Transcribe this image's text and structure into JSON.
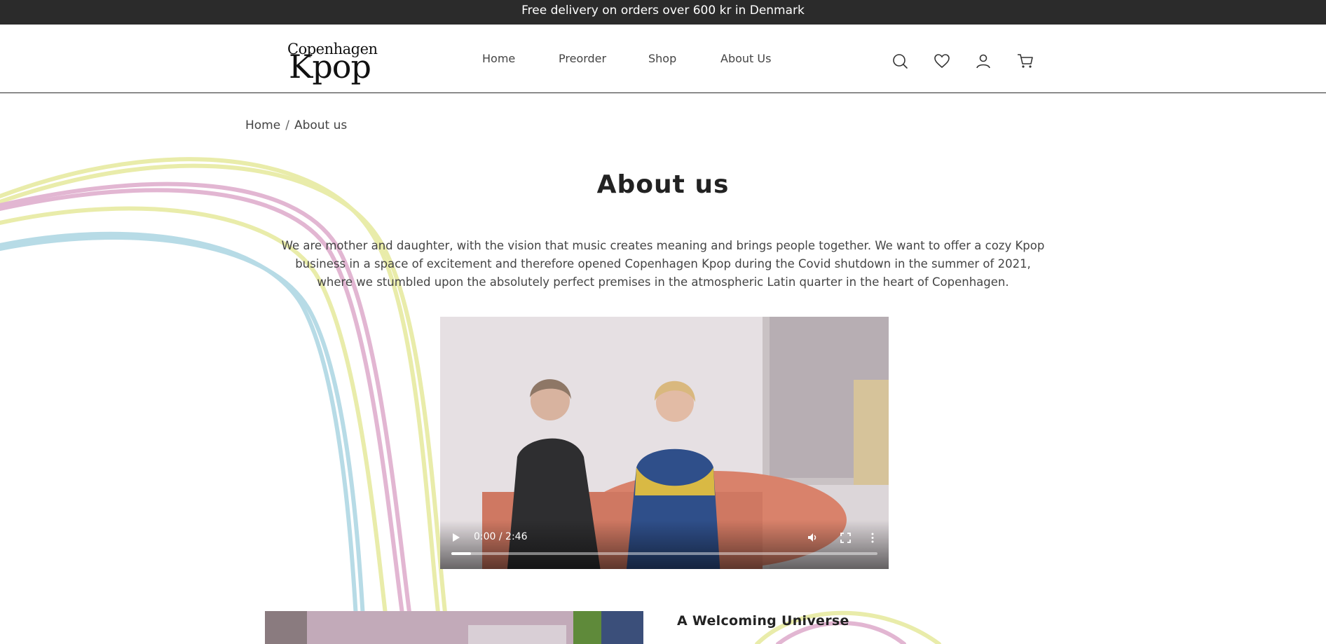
{
  "announcement": "Free delivery on orders over 600 kr in Denmark",
  "logo": {
    "line1": "Copenhagen",
    "line2": "Kpop"
  },
  "nav": [
    {
      "label": "Home"
    },
    {
      "label": "Preorder"
    },
    {
      "label": "Shop"
    },
    {
      "label": "About Us"
    }
  ],
  "header_icons": [
    "search-icon",
    "heart-icon",
    "account-icon",
    "cart-icon"
  ],
  "breadcrumb": {
    "home": "Home",
    "separator": "/",
    "current": "About us"
  },
  "page_title": "About us",
  "intro_text": "We are mother and daughter, with the vision that music creates meaning and brings people together. We want to offer a cozy Kpop business in a space of excitement and therefore opened Copenhagen Kpop during the Covid shutdown in the summer of 2021, where we stumbled upon the absolutely perfect premises in the atmospheric Latin quarter in the heart of Copenhagen.",
  "video": {
    "time": "0:00 / 2:46",
    "progress": 0.0
  },
  "section": {
    "title": "A Welcoming Universe"
  },
  "colors": {
    "topbar": "#2b2b2b",
    "ribbon_yellow": "#e9ecaa",
    "ribbon_pink": "#e2b6d2",
    "ribbon_blue": "#b7dbe6"
  }
}
